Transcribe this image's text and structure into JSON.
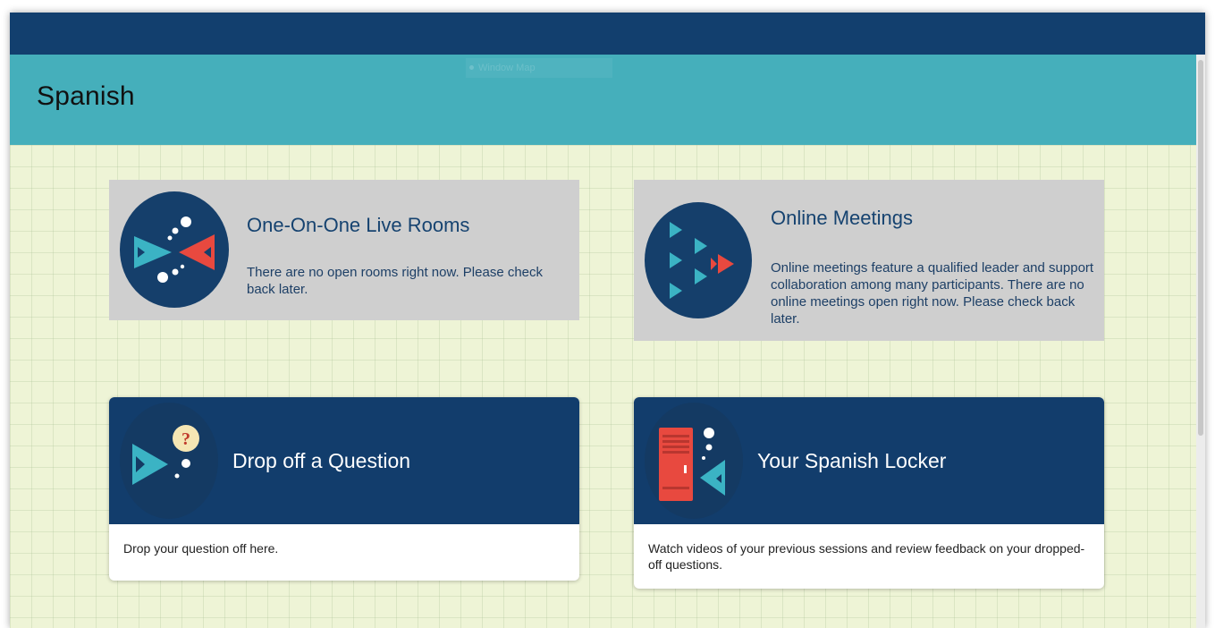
{
  "header": {
    "title": "Spanish",
    "hint": "Window Map"
  },
  "cards": {
    "live_rooms": {
      "title": "One-On-One Live Rooms",
      "description": "There are no open rooms right now. Please check back later."
    },
    "online_meetings": {
      "title": "Online Meetings",
      "description": "Online meetings feature a qualified leader and support collaboration among many participants. There are no online meetings open right now. Please check back later."
    },
    "drop_question": {
      "title": "Drop off a Question",
      "description": "Drop your question off here."
    },
    "locker": {
      "title": "Your Spanish Locker",
      "description": "Watch videos of your previous sessions and review feedback on your dropped-off questions."
    }
  },
  "colors": {
    "topbar": "#123f6e",
    "header": "#45afbb",
    "card_navy": "#123d6c",
    "card_gray": "#cfcfcf",
    "fish_teal": "#3bb3c4",
    "fish_red": "#e8493f"
  },
  "icons": {
    "live_rooms": "two-fish-icon",
    "online_meetings": "school-of-fish-icon",
    "drop_question": "fish-question-icon",
    "locker": "locker-fish-icon"
  }
}
